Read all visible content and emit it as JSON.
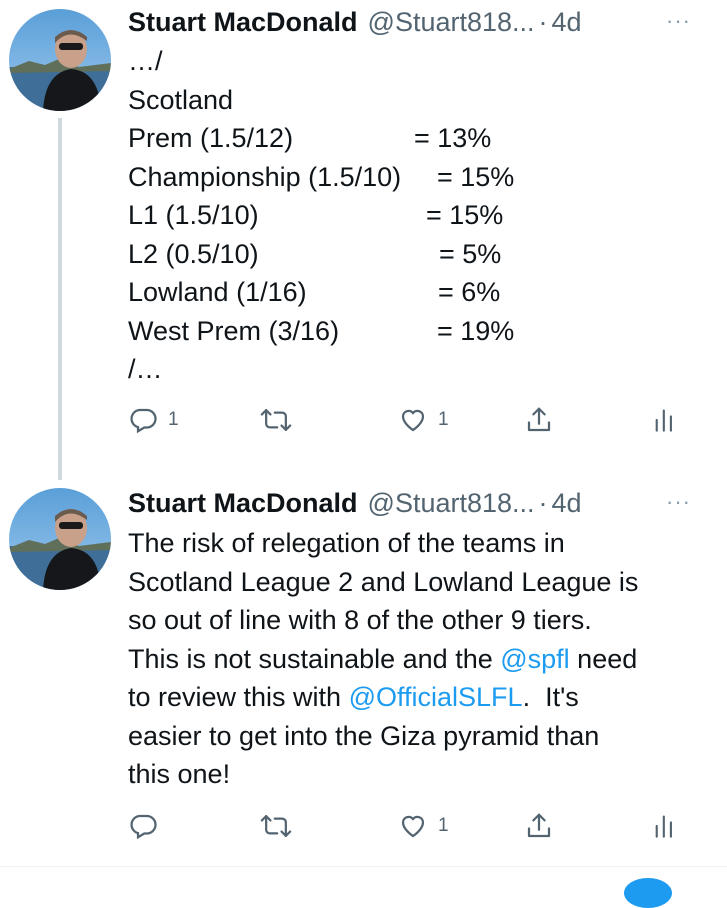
{
  "tweets": [
    {
      "author_name": "Stuart MacDonald",
      "handle": "@Stuart818...",
      "separator": "·",
      "time": "4d",
      "more_label": "···",
      "avatar_icon": "profile-photo",
      "intro_lines": [
        "…/",
        "Scotland"
      ],
      "table_rows": [
        {
          "label": "Prem (1.5/12)",
          "value": "= 13%"
        },
        {
          "label": "Championship (1.5/10)",
          "value": "= 15%"
        },
        {
          "label": "L1 (1.5/10)",
          "value": "= 15%"
        },
        {
          "label": "L2 (0.5/10)",
          "value": "= 5%"
        },
        {
          "label": "Lowland (1/16)",
          "value": "= 6%"
        },
        {
          "label": "West Prem (3/16)",
          "value": "= 19%"
        }
      ],
      "outro_line": "/…",
      "actions": {
        "reply_count": "1",
        "retweet_count": "",
        "like_count": "1"
      }
    },
    {
      "author_name": "Stuart MacDonald",
      "handle": "@Stuart818...",
      "separator": "·",
      "time": "4d",
      "more_label": "···",
      "avatar_icon": "profile-photo",
      "text_lines": [
        "The risk of relegation of the teams in",
        "Scotland League 2 and Lowland League is",
        "so out of line with 8 of the other 9 tiers.",
        "This is not sustainable and the ",
        "@spfl",
        " need",
        "to review this with ",
        "@OfficialSLFL",
        ".  It's",
        "easier to get into the Giza pyramid than",
        "this one!"
      ],
      "actions": {
        "reply_count": "",
        "retweet_count": "",
        "like_count": "1"
      }
    }
  ],
  "colors": {
    "mention": "#1d9bf0",
    "secondary": "#536471",
    "thread_line": "#cfd9de"
  }
}
